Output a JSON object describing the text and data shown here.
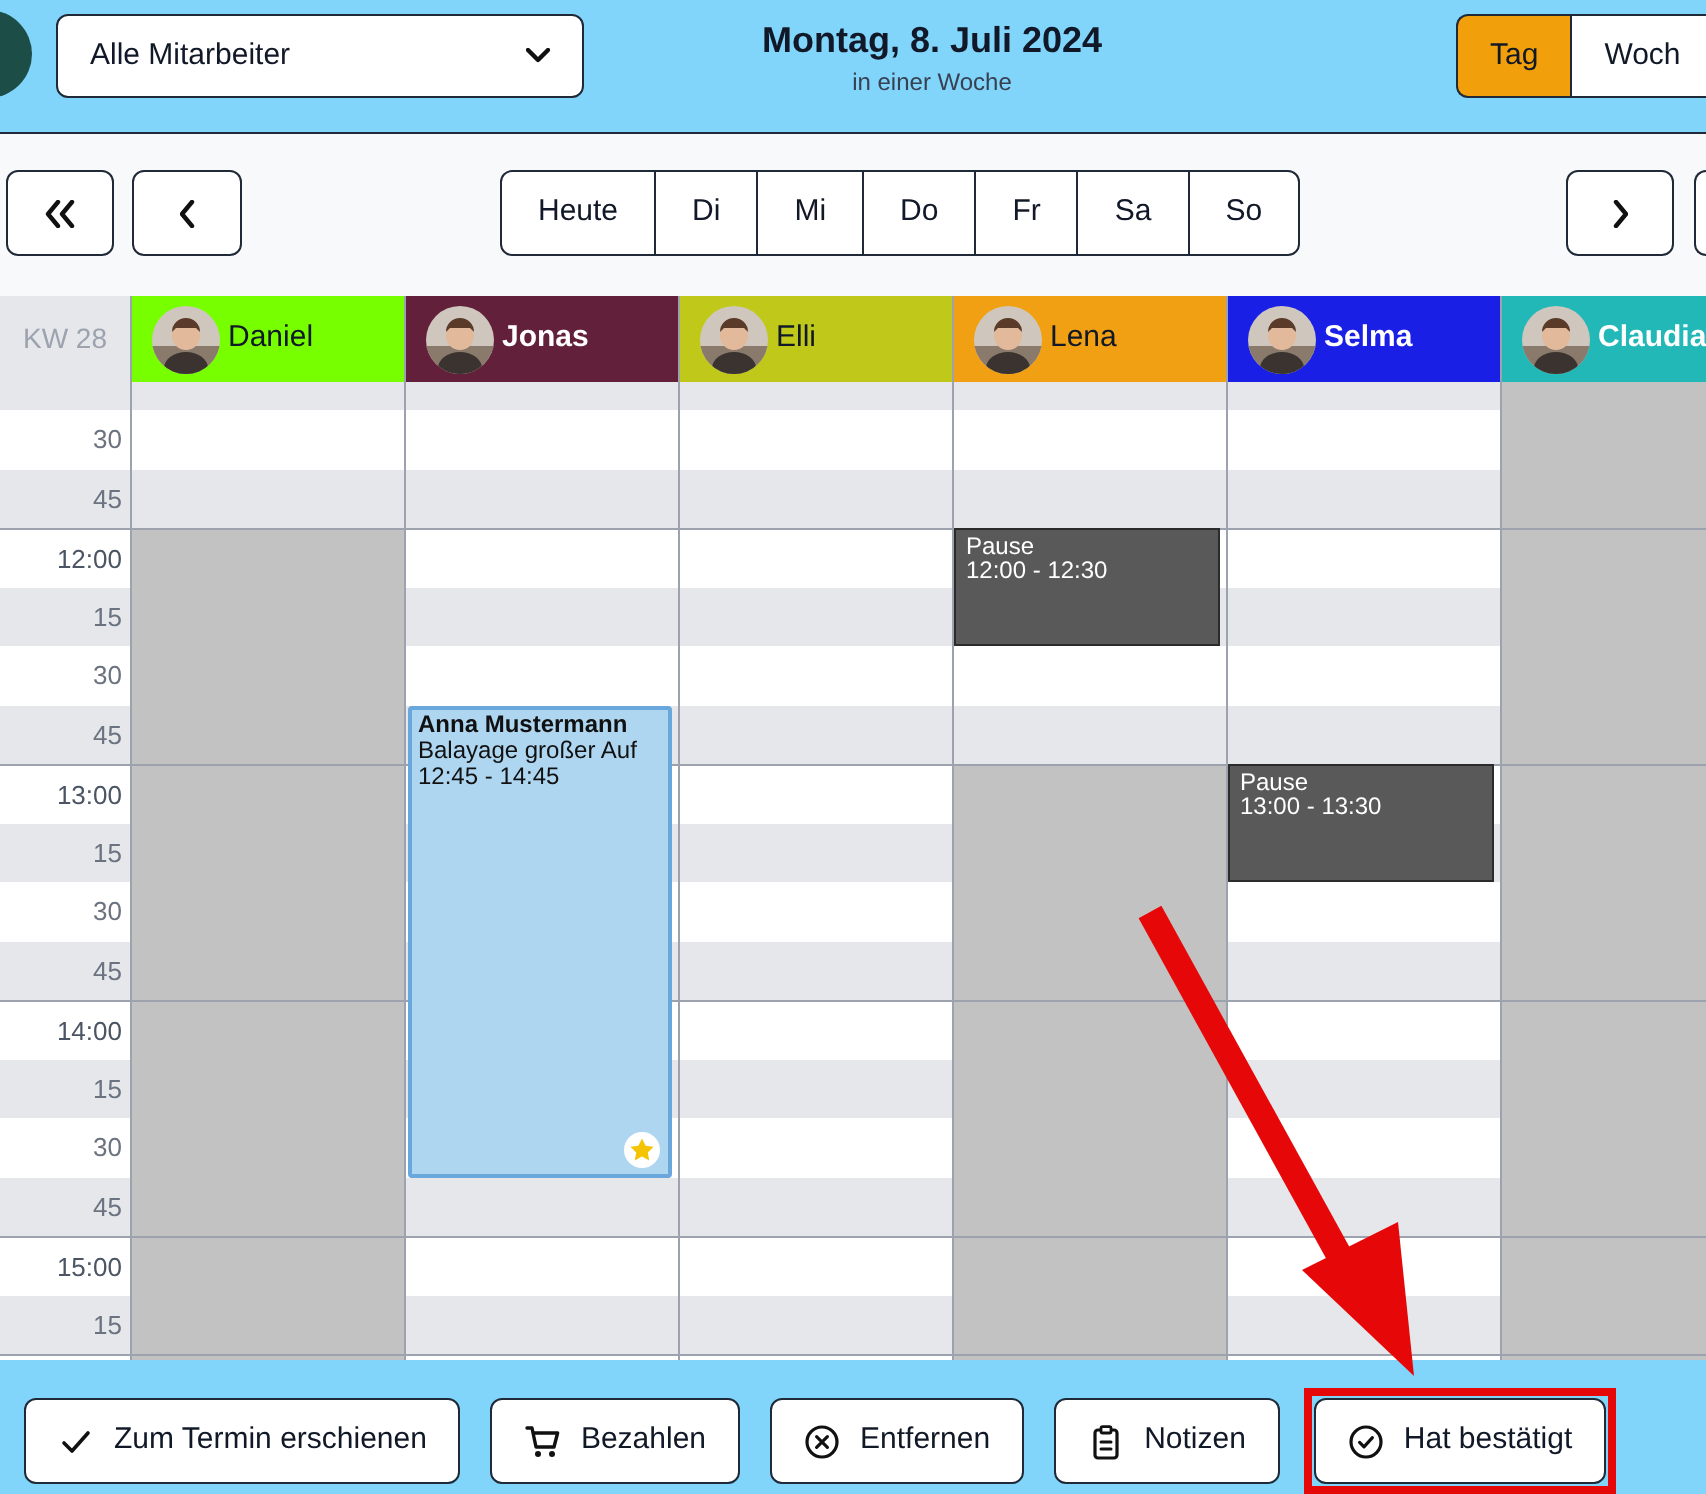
{
  "header": {
    "employee_filter": "Alle Mitarbeiter",
    "date": "Montag, 8. Juli 2024",
    "relative_date": "in einer Woche",
    "view_toggle": [
      {
        "label": "Tag",
        "selected": true
      },
      {
        "label": "Woch",
        "selected": false
      }
    ]
  },
  "day_buttons": [
    "Heute",
    "Di",
    "Mi",
    "Do",
    "Fr",
    "Sa",
    "So"
  ],
  "week_label": "KW 28",
  "staff": [
    {
      "name": "Daniel",
      "color": "#77ff00"
    },
    {
      "name": "Jonas",
      "color": "#63203a",
      "events": [
        {
          "kind": "appointment",
          "title": "Anna Mustermann",
          "service": "Balayage großer Auf",
          "time": "12:45 - 14:45",
          "starred": true
        }
      ]
    },
    {
      "name": "Elli",
      "color": "#c0c91a"
    },
    {
      "name": "Lena",
      "color": "#f0a012",
      "events": [
        {
          "kind": "pause",
          "title": "Pause",
          "time": "12:00 - 12:30"
        }
      ]
    },
    {
      "name": "Selma",
      "color": "#1a1fe6",
      "events": [
        {
          "kind": "pause",
          "title": "Pause",
          "time": "13:00 - 13:30"
        }
      ]
    },
    {
      "name": "Claudia",
      "color": "#22b8b8"
    }
  ],
  "rows": [
    {
      "time": "30",
      "kind": "quarter",
      "blocked": [
        false,
        false,
        false,
        false,
        false,
        true
      ]
    },
    {
      "time": "45",
      "kind": "quarter",
      "blocked": [
        false,
        false,
        false,
        false,
        false,
        true
      ]
    },
    {
      "time": "12:00",
      "kind": "hour",
      "blocked": [
        true,
        false,
        false,
        false,
        false,
        true
      ]
    },
    {
      "time": "15",
      "kind": "quarter",
      "blocked": [
        true,
        false,
        false,
        false,
        false,
        true
      ]
    },
    {
      "time": "30",
      "kind": "quarter",
      "blocked": [
        true,
        false,
        false,
        false,
        false,
        true
      ]
    },
    {
      "time": "45",
      "kind": "quarter",
      "blocked": [
        true,
        false,
        false,
        false,
        false,
        true
      ]
    },
    {
      "time": "13:00",
      "kind": "hour",
      "blocked": [
        true,
        false,
        false,
        true,
        false,
        true
      ]
    },
    {
      "time": "15",
      "kind": "quarter",
      "blocked": [
        true,
        false,
        false,
        true,
        false,
        true
      ]
    },
    {
      "time": "30",
      "kind": "quarter",
      "blocked": [
        true,
        false,
        false,
        true,
        false,
        true
      ]
    },
    {
      "time": "45",
      "kind": "quarter",
      "blocked": [
        true,
        false,
        false,
        true,
        false,
        true
      ]
    },
    {
      "time": "14:00",
      "kind": "hour",
      "blocked": [
        true,
        false,
        false,
        true,
        false,
        true
      ]
    },
    {
      "time": "15",
      "kind": "quarter",
      "blocked": [
        true,
        false,
        false,
        true,
        false,
        true
      ]
    },
    {
      "time": "30",
      "kind": "quarter",
      "blocked": [
        true,
        false,
        false,
        true,
        false,
        true
      ]
    },
    {
      "time": "45",
      "kind": "quarter",
      "blocked": [
        true,
        false,
        false,
        true,
        false,
        true
      ]
    },
    {
      "time": "15:00",
      "kind": "hour",
      "blocked": [
        true,
        false,
        false,
        true,
        false,
        true
      ]
    },
    {
      "time": "15",
      "kind": "quarter",
      "blocked": [
        true,
        false,
        false,
        true,
        false,
        true
      ]
    }
  ],
  "actions": [
    {
      "label": "Zum Termin erschienen",
      "highlighted": false
    },
    {
      "label": "Bezahlen",
      "highlighted": false
    },
    {
      "label": "Entfernen",
      "highlighted": false
    },
    {
      "label": "Notizen",
      "highlighted": false
    },
    {
      "label": "Hat bestätigt",
      "highlighted": true
    }
  ]
}
